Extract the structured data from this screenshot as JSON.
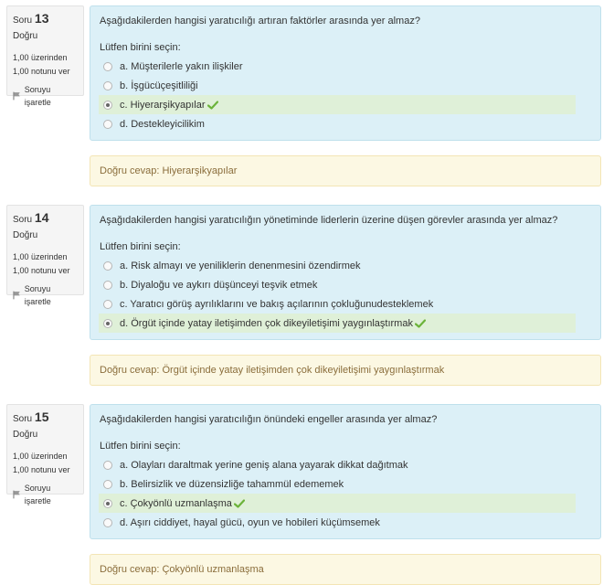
{
  "questions": [
    {
      "label": "Soru",
      "number": "13",
      "state": "Doğru",
      "grade_line1": "1,00 üzerinden",
      "grade_line2": "1,00 notunu ver",
      "flag_label": "Soruyu işaretle",
      "text": "Aşağıdakilerden hangisi yaratıcılığı artıran faktörler arasında yer almaz?",
      "prompt": "Lütfen birini seçin:",
      "answers": [
        "a. Müşterilerle yakın ilişkiler",
        "b. İşgücüçeşitliliği",
        "c. Hiyerarşikyapılar",
        "d. Destekleyicilikim"
      ],
      "selected": "c",
      "correct_answer": "Doğru cevap: Hiyerarşikyapılar"
    },
    {
      "label": "Soru",
      "number": "14",
      "state": "Doğru",
      "grade_line1": "1,00 üzerinden",
      "grade_line2": "1,00 notunu ver",
      "flag_label": "Soruyu işaretle",
      "text": "Aşağıdakilerden hangisi yaratıcılığın yönetiminde liderlerin üzerine düşen görevler arasında yer almaz?",
      "prompt": "Lütfen birini seçin:",
      "answers": [
        "a. Risk almayı ve yeniliklerin denenmesini özendirmek",
        "b. Diyaloğu ve aykırı düşünceyi teşvik etmek",
        "c. Yaratıcı görüş ayrılıklarını ve bakış açılarının çokluğunudesteklemek",
        "d. Örgüt içinde yatay iletişimden çok dikeyiletişimi yaygınlaştırmak"
      ],
      "selected": "d",
      "correct_answer": "Doğru cevap: Örgüt içinde yatay iletişimden çok dikeyiletişimi yaygınlaştırmak"
    },
    {
      "label": "Soru",
      "number": "15",
      "state": "Doğru",
      "grade_line1": "1,00 üzerinden",
      "grade_line2": "1,00 notunu ver",
      "flag_label": "Soruyu işaretle",
      "text": "Aşağıdakilerden hangisi yaratıcılığın önündeki engeller arasında yer almaz?",
      "prompt": "Lütfen birini seçin:",
      "answers": [
        "a. Olayları daraltmak yerine geniş alana yayarak dikkat dağıtmak",
        "b. Belirsizlik ve düzensizliğe tahammül edememek",
        "c. Çokyönlü uzmanlaşma",
        "d. Aşırı ciddiyet, hayal gücü, oyun ve hobileri küçümsemek"
      ],
      "selected": "c",
      "correct_answer": "Doğru cevap: Çokyönlü uzmanlaşma"
    }
  ],
  "icons": {
    "flag": "flag-icon",
    "check": "check-icon",
    "check_color": "#6bb33a"
  }
}
